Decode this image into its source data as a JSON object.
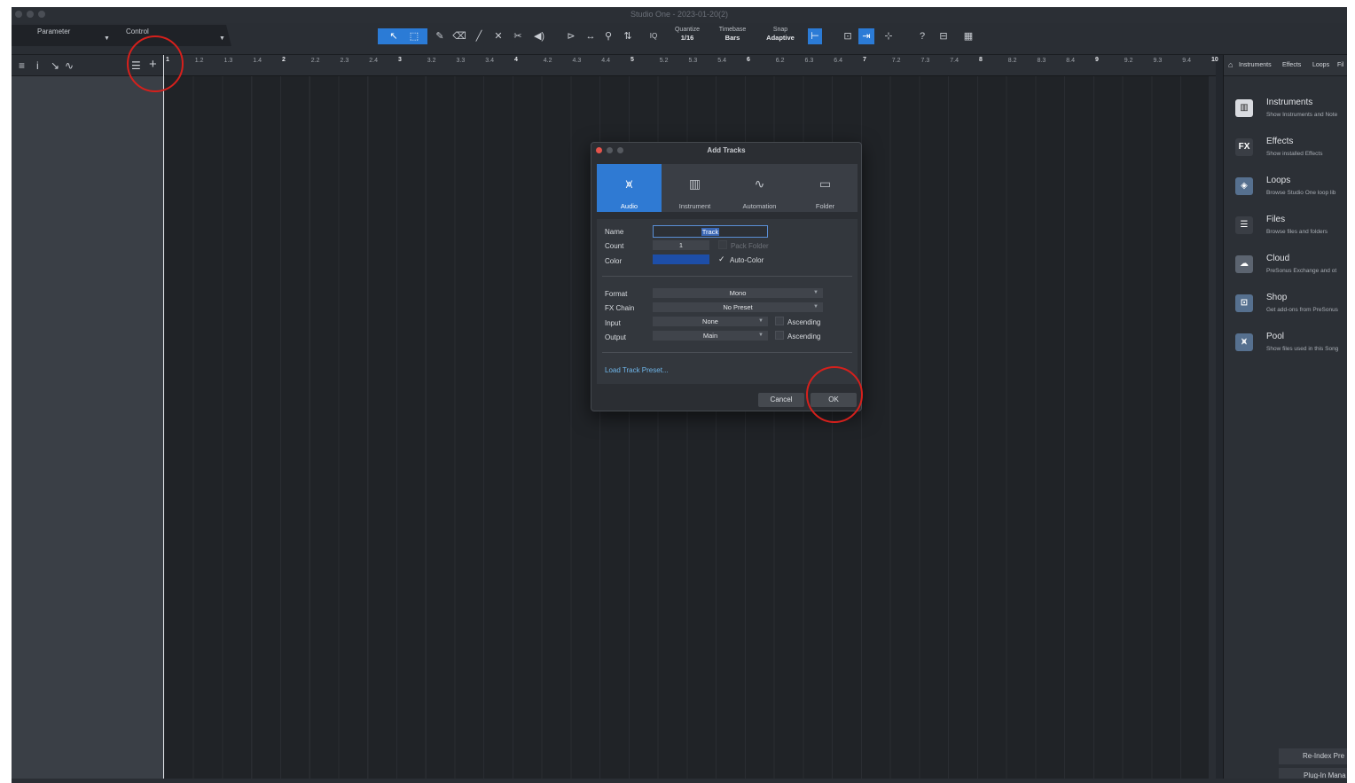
{
  "window": {
    "title": "Studio One - 2023-01-20(2)"
  },
  "param_panel": {
    "parameter_label": "Parameter",
    "control_label": "Control"
  },
  "toolbar": {
    "iq_label": "IQ",
    "quantize": {
      "label": "Quantize",
      "value": "1/16"
    },
    "timebase": {
      "label": "Timebase",
      "value": "Bars"
    },
    "snap": {
      "label": "Snap",
      "value": "Adaptive"
    },
    "help_label": "?"
  },
  "ruler": {
    "ticks": [
      "1",
      "1.2",
      "1.3",
      "1.4",
      "2",
      "2.2",
      "2.3",
      "2.4",
      "3",
      "3.2",
      "3.3",
      "3.4",
      "4",
      "4.2",
      "4.3",
      "4.4",
      "5",
      "5.2",
      "5.3",
      "5.4",
      "6",
      "6.2",
      "6.3",
      "6.4",
      "7",
      "7.2",
      "7.3",
      "7.4",
      "8",
      "8.2",
      "8.3",
      "8.4",
      "9",
      "9.2",
      "9.3",
      "9.4",
      "10"
    ]
  },
  "browser": {
    "tabs": [
      "Instruments",
      "Effects",
      "Loops",
      "Fil"
    ],
    "items": [
      {
        "title": "Instruments",
        "desc": "Show Instruments and Note",
        "icon": "piano-icon"
      },
      {
        "title": "Effects",
        "desc": "Show installed Effects",
        "icon": "fx-icon",
        "glyph": "FX"
      },
      {
        "title": "Loops",
        "desc": "Browse Studio One loop lib",
        "icon": "loops-icon"
      },
      {
        "title": "Files",
        "desc": "Browse files and folders",
        "icon": "files-icon"
      },
      {
        "title": "Cloud",
        "desc": "PreSonus Exchange and ot",
        "icon": "cloud-icon"
      },
      {
        "title": "Shop",
        "desc": "Get add-ons from PreSonus",
        "icon": "shop-icon"
      },
      {
        "title": "Pool",
        "desc": "Show files used in this Song",
        "icon": "pool-icon"
      }
    ],
    "reindex_label": "Re-Index Pre",
    "plugin_manager_label": "Plug-In Mana"
  },
  "dialog": {
    "title": "Add Tracks",
    "track_types": [
      "Audio",
      "Instrument",
      "Automation",
      "Folder"
    ],
    "selected_type": "Audio",
    "name_label": "Name",
    "name_value": "Track",
    "count_label": "Count",
    "count_value": "1",
    "pack_folder_label": "Pack Folder",
    "color_label": "Color",
    "color_value": "#1d4ea8",
    "auto_color_label": "Auto-Color",
    "auto_color_check": "✓",
    "format_label": "Format",
    "format_value": "Mono",
    "fxchain_label": "FX Chain",
    "fxchain_value": "No Preset",
    "input_label": "Input",
    "input_value": "None",
    "output_label": "Output",
    "output_value": "Main",
    "ascending_label": "Ascending",
    "load_preset_label": "Load Track Preset...",
    "cancel_label": "Cancel",
    "ok_label": "OK"
  },
  "annotation_color": "#d6201c"
}
